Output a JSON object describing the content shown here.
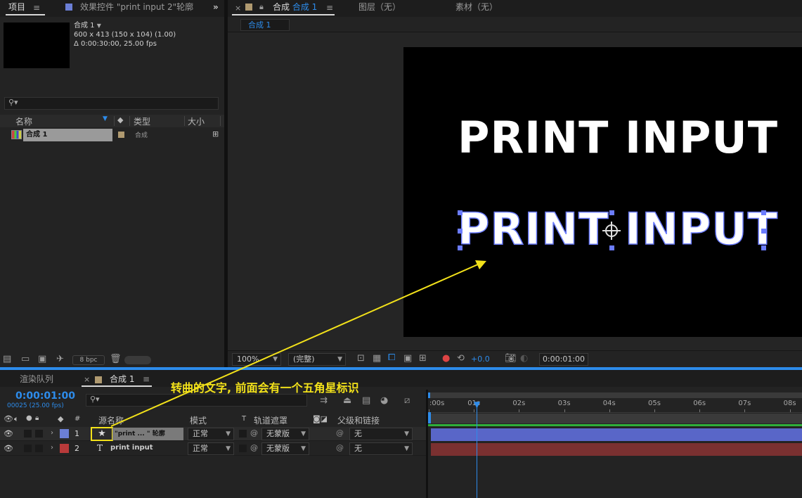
{
  "project_panel": {
    "tab_label": "项目",
    "effects_tab_label": "效果控件 \"print input 2\"轮廓",
    "more_label": "»",
    "comp_name": "合成 1",
    "comp_dims": "600 x 413  (150 x 104) (1.00)",
    "comp_duration": "Δ 0:00:30:00, 25.00 fps",
    "search_placeholder": "",
    "columns": {
      "name": "名称",
      "type": "类型",
      "size": "大小"
    },
    "items": [
      {
        "name": "合成 1",
        "type": "合成"
      }
    ],
    "bpc_label": "8 bpc"
  },
  "comp_panel": {
    "close_label": "×",
    "tab_prefix": "合成",
    "tab_comp_name": "合成 1",
    "layer_tab": "图层（无）",
    "footage_tab": "素材（无）",
    "breadcrumb": "合成 1",
    "canvas_texts": [
      "PRINT INPUT",
      "PRINT INPUT"
    ],
    "zoom": "100%",
    "resolution": "(完整)",
    "exposure": "+0.0",
    "timecode": "0:00:01:00"
  },
  "timeline": {
    "render_queue_tab": "渲染队列",
    "comp_tab": "合成 1",
    "timecode": "0:00:01:00",
    "frame_info": "00025 (25.00 fps)",
    "annotation": "转曲的文字, 前面会有一个五角星标识",
    "columns": {
      "hash": "#",
      "source_name": "源名称",
      "mode": "模式",
      "t": "T",
      "track_matte": "轨道遮罩",
      "parent": "父级和链接"
    },
    "layers": [
      {
        "num": "1",
        "icon": "★",
        "name": "\"print ... \" 轮廓",
        "mode": "正常",
        "matte": "无蒙版",
        "parent": "无",
        "color": "#6b7fd6"
      },
      {
        "num": "2",
        "icon": "T",
        "name": "print input",
        "mode": "正常",
        "matte": "无蒙版",
        "parent": "无",
        "color": "#b83a3a"
      }
    ],
    "ruler_ticks": [
      ":00s",
      "01s",
      "02s",
      "03s",
      "04s",
      "05s",
      "06s",
      "07s",
      "08s"
    ]
  }
}
